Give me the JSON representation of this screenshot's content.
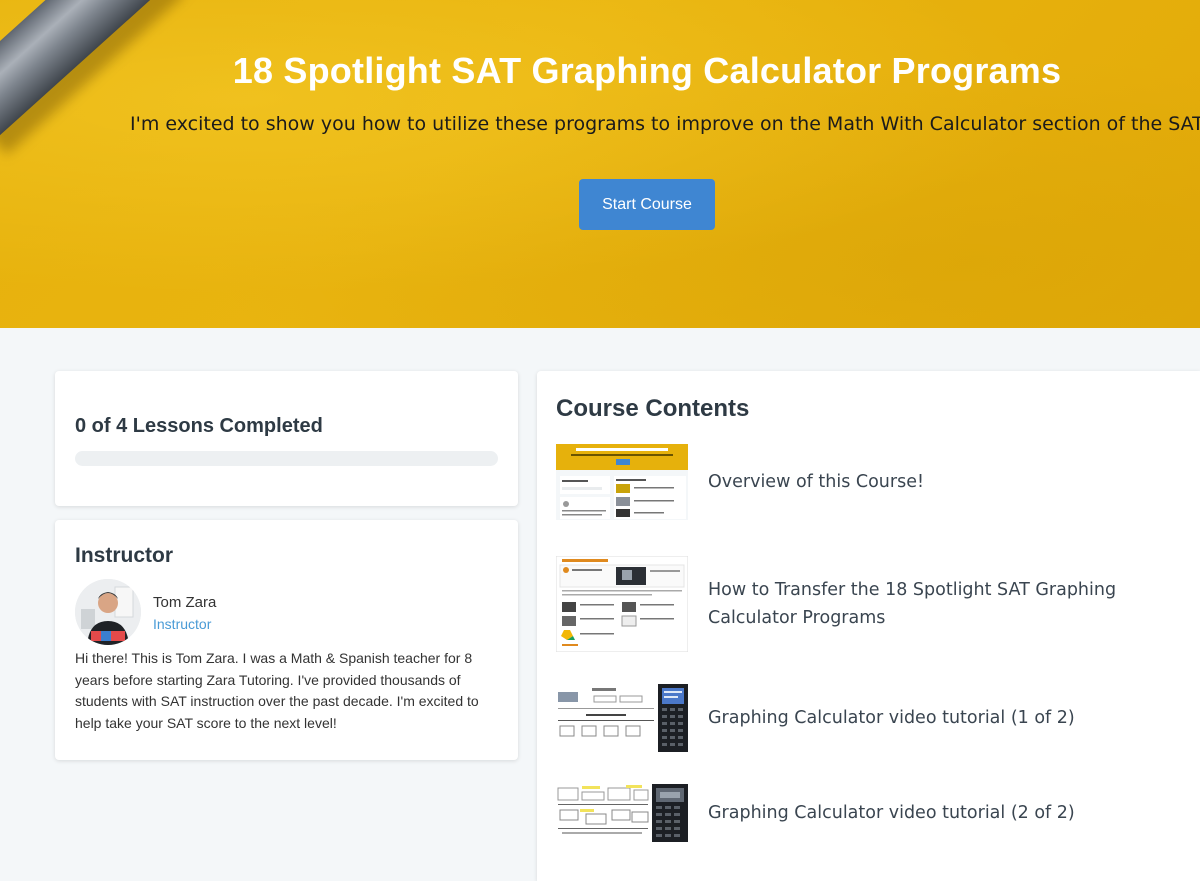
{
  "hero": {
    "title": "18 Spotlight SAT Graphing Calculator Programs",
    "subtitle": "I'm excited to show you how to utilize these programs to improve on the Math With Calculator section of the SAT!",
    "start_button_label": "Start Course"
  },
  "progress": {
    "label": "0 of 4 Lessons Completed",
    "completed": 0,
    "total": 4,
    "fraction": 0
  },
  "instructor": {
    "heading": "Instructor",
    "name": "Tom Zara",
    "role": "Instructor",
    "bio": "Hi there! This is Tom Zara. I was a Math & Spanish teacher for 8 years before starting Zara Tutoring. I've provided thousands of students with SAT instruction over the past decade. I'm excited to help take your SAT score to the next level!"
  },
  "course_contents": {
    "heading": "Course Contents",
    "lessons": [
      {
        "title": "Overview of this Course!",
        "thumbnail": "course-page-screenshot"
      },
      {
        "title": "How to Transfer the 18 Spotlight SAT Graphing Calculator Programs",
        "thumbnail": "graphing-calculator-videos-screenshot"
      },
      {
        "title": "Graphing Calculator video tutorial (1 of 2)",
        "thumbnail": "calculator-tutorial-1"
      },
      {
        "title": "Graphing Calculator video tutorial (2 of 2)",
        "thumbnail": "calculator-tutorial-2"
      }
    ]
  },
  "colors": {
    "hero_yellow": "#e6b10c",
    "button_blue": "#3f86d2",
    "link_blue": "#4a9bd6",
    "page_bg": "#f4f7f9"
  }
}
